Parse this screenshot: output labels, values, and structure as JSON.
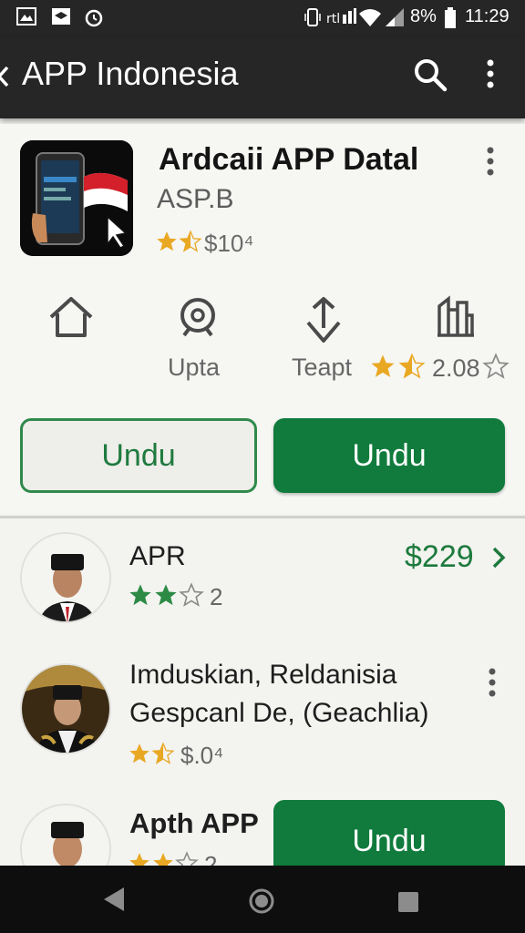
{
  "status_bar": {
    "battery": "8%",
    "time": "11:29"
  },
  "app_bar": {
    "title": "APP Indonesia"
  },
  "detail": {
    "app_name": "Ardcaii APP Datal",
    "developer": "ASP.B",
    "price": "$10⁴",
    "rating_stars": 1.5,
    "actions": [
      {
        "icon": "home-icon",
        "label": ""
      },
      {
        "icon": "search-person-icon",
        "label": "Upta"
      },
      {
        "icon": "share-icon",
        "label": "Teapt"
      },
      {
        "icon": "building-icon",
        "label": ""
      }
    ],
    "rating_value": "2.08",
    "buttons": {
      "secondary": "Undu",
      "primary": "Undu"
    }
  },
  "list": [
    {
      "name": "APR",
      "rating_stars": 2,
      "rating_value": "2",
      "price": "$229"
    },
    {
      "name": "Imduskian, Reldanisia",
      "subtitle": "Gespcanl De, (Geachlia)",
      "rating_stars": 1.5,
      "rating_value": "$.0⁴"
    },
    {
      "name": "Apth APP",
      "rating_stars": 1.5,
      "rating_value": "2",
      "button": "Undu"
    }
  ],
  "colors": {
    "accent": "#107b3c",
    "star": "#e9a823",
    "header": "#262626"
  }
}
